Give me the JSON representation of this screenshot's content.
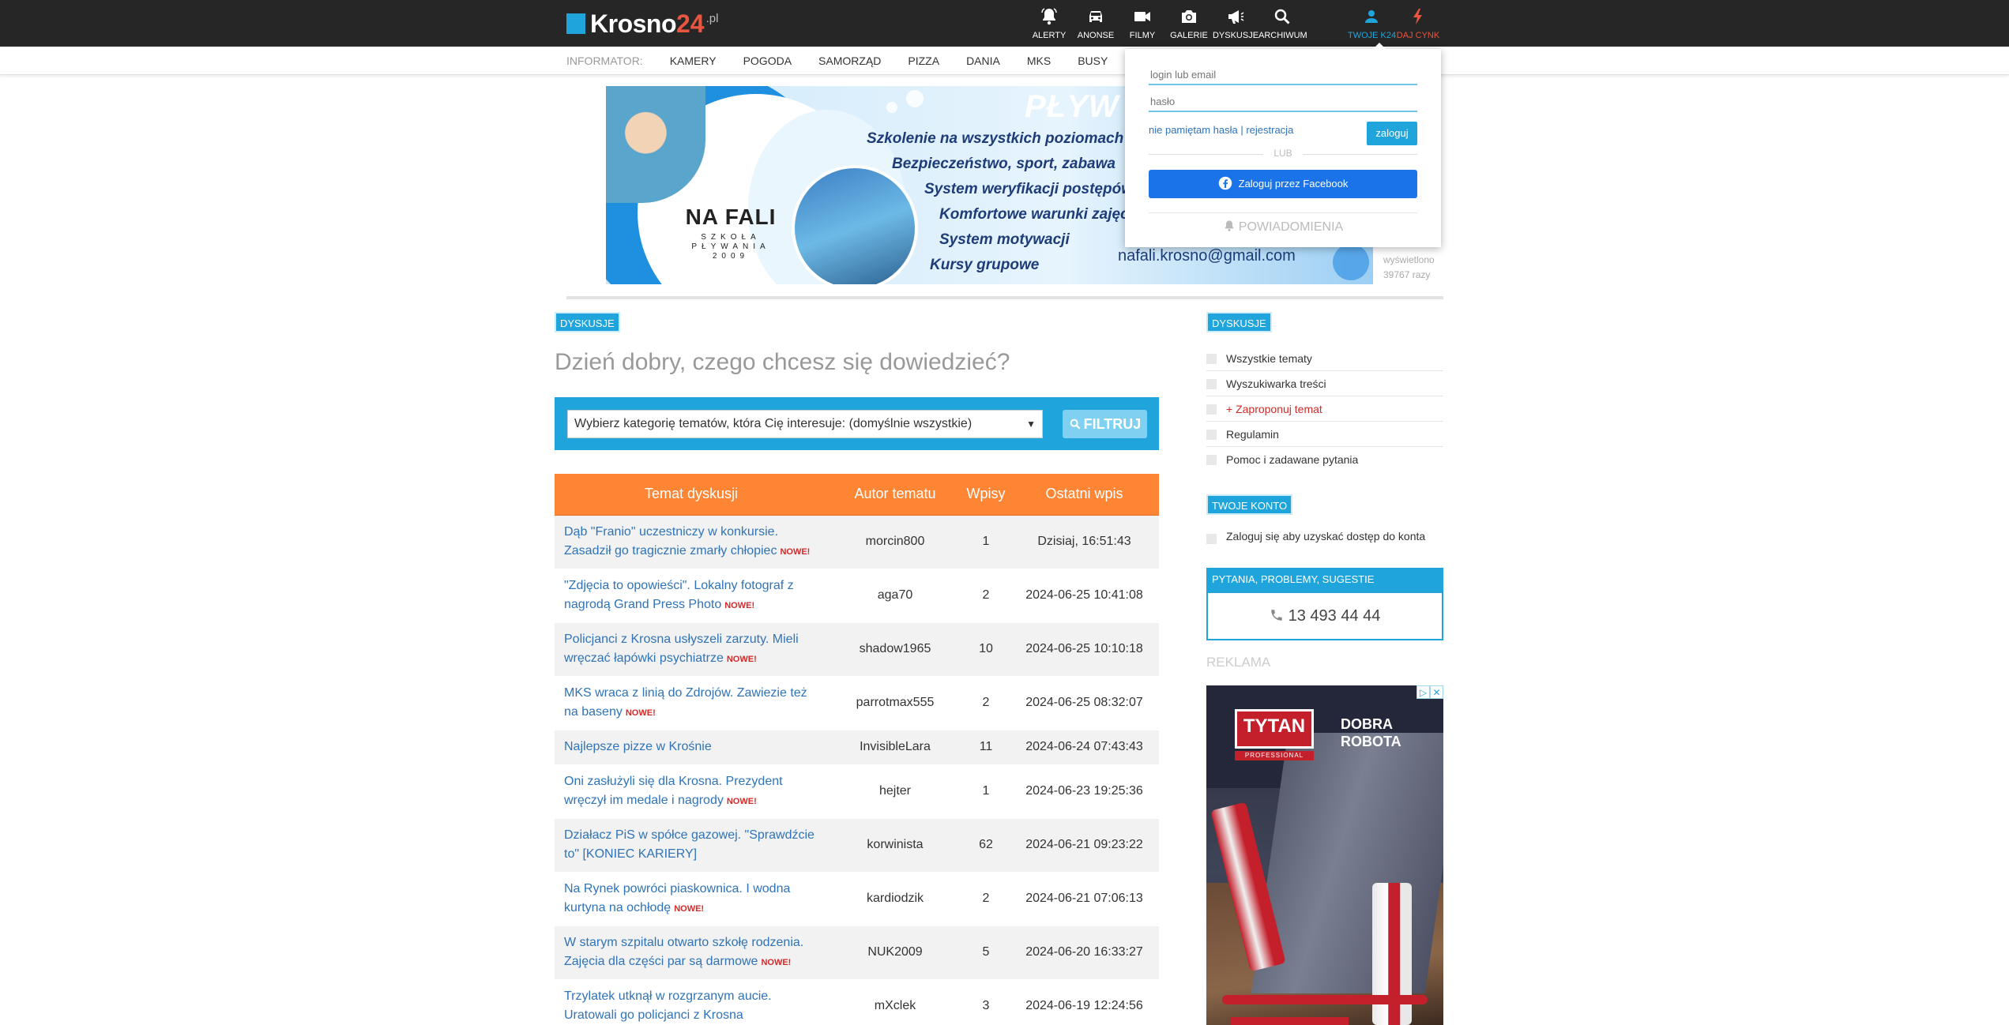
{
  "header": {
    "logo_text": "Krosno",
    "logo_num": "24",
    "logo_tld": ".pl",
    "nav": [
      {
        "label": "ALERTY",
        "icon": "bell-icon"
      },
      {
        "label": "ANONSE",
        "icon": "car-icon"
      },
      {
        "label": "FILMY",
        "icon": "video-camera-icon"
      },
      {
        "label": "GALERIE",
        "icon": "photo-camera-icon"
      },
      {
        "label": "DYSKUSJE",
        "icon": "megaphone-icon"
      },
      {
        "label": "ARCHIWUM",
        "icon": "search-icon"
      },
      {
        "label": "TWOJE K24",
        "icon": "user-icon"
      },
      {
        "label": "DAJ CYNK",
        "icon": "lightning-icon"
      }
    ]
  },
  "subnav": {
    "label": "INFORMATOR:",
    "items": [
      "KAMERY",
      "POGODA",
      "SAMORZĄD",
      "PIZZA",
      "DANIA",
      "MKS",
      "BUSY"
    ]
  },
  "banner": {
    "headline": "PŁYW",
    "brand": "NA FALI",
    "brand_sub": "SZKOŁA PŁYWANIA 2009",
    "lines": [
      "Szkolenie na wszystkich poziomach",
      "Bezpieczeństwo, sport, zabawa",
      "System weryfikacji postępów",
      "Komfortowe warunki zajęć",
      "System motywacji",
      "Kursy grupowe"
    ],
    "email": "nafali.krosno@gmail.com",
    "views_label": "wyświetlono",
    "views_count": "39767 razy"
  },
  "main": {
    "tag": "DYSKUSJE",
    "greeting": "Dzień dobry, czego chcesz się dowiedzieć?",
    "filter_select": "Wybierz kategorię tematów, która Cię interesuje: (domyślnie wszystkie)",
    "filter_button": "FILTRUJ",
    "table_headers": [
      "Temat dyskusji",
      "Autor tematu",
      "Wpisy",
      "Ostatni wpis"
    ],
    "new_label": "NOWE!",
    "rows": [
      {
        "title": "Dąb \"Franio\" uczestniczy w konkursie. Zasadził go tragicznie zmarły chłopiec",
        "is_new": true,
        "author": "morcin800",
        "posts": "1",
        "last": "Dzisiaj, 16:51:43"
      },
      {
        "title": "\"Zdjęcia to opowieści\". Lokalny fotograf z nagrodą Grand Press Photo",
        "is_new": true,
        "author": "aga70",
        "posts": "2",
        "last": "2024-06-25 10:41:08"
      },
      {
        "title": "Policjanci z Krosna usłyszeli zarzuty. Mieli wręczać łapówki psychiatrze",
        "is_new": true,
        "author": "shadow1965",
        "posts": "10",
        "last": "2024-06-25 10:10:18"
      },
      {
        "title": "MKS wraca z linią do Zdrojów. Zawiezie też na baseny",
        "is_new": true,
        "author": "parrotmax555",
        "posts": "2",
        "last": "2024-06-25 08:32:07"
      },
      {
        "title": "Najlepsze pizze w Krośnie",
        "is_new": false,
        "author": "InvisibleLara",
        "posts": "11",
        "last": "2024-06-24 07:43:43"
      },
      {
        "title": "Oni zasłużyli się dla Krosna. Prezydent wręczył im medale i nagrody",
        "is_new": true,
        "author": "hejter",
        "posts": "1",
        "last": "2024-06-23 19:25:36"
      },
      {
        "title": "Działacz PiS w spółce gazowej. \"Sprawdźcie to\" [KONIEC KARIERY]",
        "is_new": false,
        "author": "korwinista",
        "posts": "62",
        "last": "2024-06-21 09:23:22"
      },
      {
        "title": "Na Rynek powróci piaskownica. I wodna kurtyna na ochłodę",
        "is_new": true,
        "author": "kardiodzik",
        "posts": "2",
        "last": "2024-06-21 07:06:13"
      },
      {
        "title": "W starym szpitalu otwarto szkołę rodzenia. Zajęcia dla części par są darmowe",
        "is_new": true,
        "author": "NUK2009",
        "posts": "5",
        "last": "2024-06-20 16:33:27"
      },
      {
        "title": "Trzylatek utknął w rozgrzanym aucie. Uratowali go policjanci z Krosna",
        "is_new": false,
        "author": "mXclek",
        "posts": "3",
        "last": "2024-06-19 12:24:56"
      }
    ]
  },
  "sidebar": {
    "tag": "DYSKUSJE",
    "items": [
      {
        "label": "Wszystkie tematy",
        "red": false
      },
      {
        "label": "Wyszukiwarka treści",
        "red": false
      },
      {
        "label": "+ Zaproponuj temat",
        "red": true
      },
      {
        "label": "Regulamin",
        "red": false
      },
      {
        "label": "Pomoc i zadawane pytania",
        "red": false
      }
    ],
    "account_tag": "TWOJE KONTO",
    "account_text": "Zaloguj się aby uzyskać dostęp do konta",
    "contact_head": "PYTANIA, PROBLEMY, SUGESTIE",
    "phone": "13 493 44 44",
    "reklama": "REKLAMA",
    "ad": {
      "brand": "TYTAN",
      "brand_sub": "PROFESSIONAL",
      "slogan": "DOBRA ROBOTA",
      "adchoice": [
        "▷",
        "✕"
      ]
    }
  },
  "login": {
    "login_placeholder": "login lub email",
    "password_placeholder": "hasło",
    "links": "nie pamiętam hasła | rejestracja",
    "login_button": "zaloguj",
    "or": "LUB",
    "facebook": "Zaloguj przez Facebook",
    "notifications": "POWIADOMIENIA"
  },
  "colors": {
    "accent": "#1fa5dc",
    "table_header": "#fd8534",
    "new_badge": "#d12a2a",
    "hot": "#e8563f"
  }
}
